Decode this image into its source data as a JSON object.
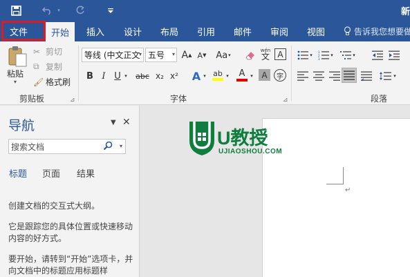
{
  "title_bar": {
    "save_icon": "save-icon",
    "undo_icon": "undo-icon",
    "redo_icon": "redo-icon",
    "customize_icon": "customize-qat-icon",
    "title": "新"
  },
  "tabs": [
    {
      "label": "文件",
      "active": false
    },
    {
      "label": "开始",
      "active": true
    },
    {
      "label": "插入",
      "active": false
    },
    {
      "label": "设计",
      "active": false
    },
    {
      "label": "布局",
      "active": false
    },
    {
      "label": "引用",
      "active": false
    },
    {
      "label": "邮件",
      "active": false
    },
    {
      "label": "审阅",
      "active": false
    },
    {
      "label": "视图",
      "active": false
    }
  ],
  "tell_me": "告诉我您想要做",
  "ribbon": {
    "clipboard": {
      "paste": "粘贴",
      "cut": "剪切",
      "copy": "复制",
      "format_painter": "格式刷",
      "label": "剪贴板"
    },
    "font": {
      "font_name": "等线 (中文正文",
      "font_size": "五号",
      "label": "字体",
      "phonetic": "wén",
      "phonetic_char": "文",
      "grow": "A",
      "shrink": "A",
      "change_case": "Aa",
      "boxed_char": "A",
      "bold": "B",
      "italic": "I",
      "underline": "U",
      "strikethrough": "abc",
      "subscript": "x₂",
      "superscript": "x²",
      "text_effect": "A",
      "highlight": "ab",
      "font_color": "A",
      "shading": "A",
      "enclose": "字"
    },
    "paragraph": {
      "label": "段落"
    }
  },
  "nav_pane": {
    "title": "导航",
    "search_placeholder": "搜索文档",
    "tabs": [
      "标题",
      "页面",
      "结果"
    ],
    "text1": "创建文档的交互式大纲。",
    "text2": "它是跟踪您的具体位置或快速移动内容的好方式。",
    "text3": "要开始，请转到“开始”选项卡，并向文档中的标题应用标题样"
  },
  "watermark": {
    "brand": "U教授",
    "site": "UJIAOSHOU.COM"
  },
  "colors": {
    "accent": "#2b579a",
    "highlight_box": "#e11a22",
    "watermark": "#0e7d3d"
  }
}
